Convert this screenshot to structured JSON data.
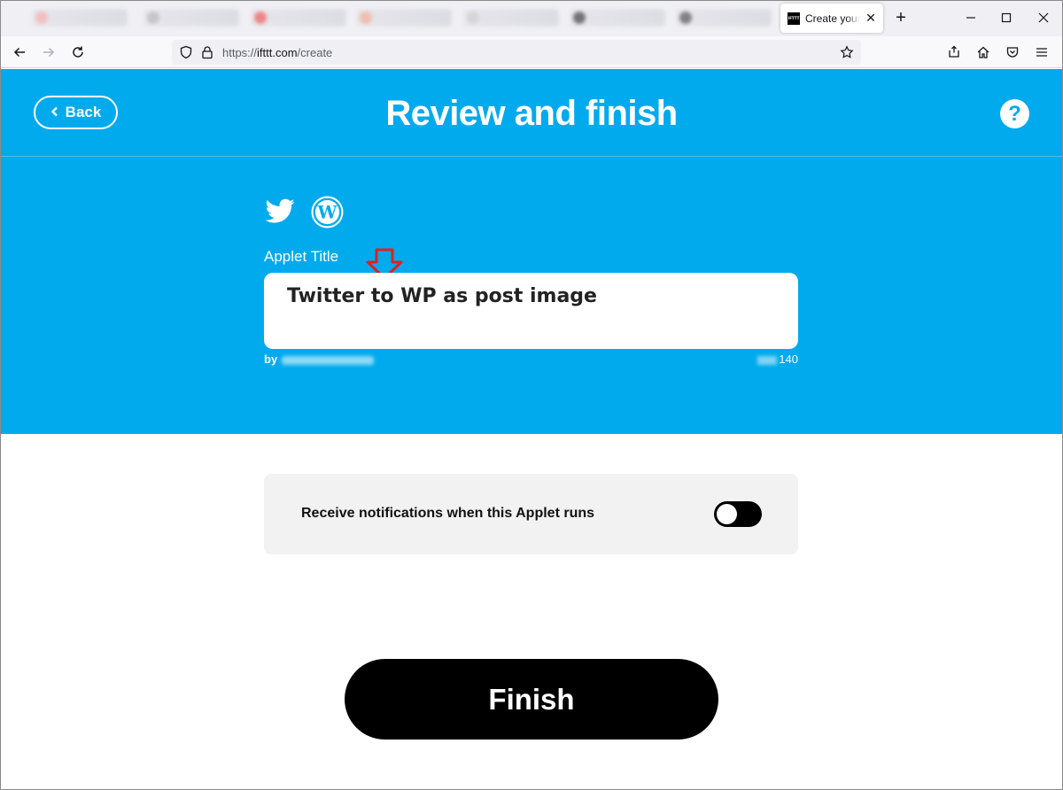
{
  "browser": {
    "active_tab": {
      "title": "Create your own",
      "favicon": "IFTTT",
      "close_icon": "close-icon"
    },
    "new_tab_label": "+",
    "url": {
      "prefix": "https://",
      "domain": "ifttt.com",
      "path": "/create"
    },
    "icons": [
      "back-arrow-icon",
      "forward-arrow-icon",
      "reload-icon",
      "shield-icon",
      "lock-icon",
      "bookmark-star-icon",
      "pocket-save-icon",
      "home-icon",
      "pocket-icon",
      "menu-icon",
      "minimize-icon",
      "maximize-icon",
      "close-window-icon"
    ]
  },
  "header": {
    "back_label": "Back",
    "title": "Review and finish",
    "help_label": "?"
  },
  "applet": {
    "services": [
      "twitter-icon",
      "wordpress-icon"
    ],
    "title_label": "Applet Title",
    "title_value": "Twitter to WP as post image",
    "by_prefix": "by",
    "max_chars": "140"
  },
  "notifications": {
    "label": "Receive notifications when this Applet runs",
    "enabled": false
  },
  "actions": {
    "finish_label": "Finish"
  },
  "colors": {
    "brand_blue": "#00aaec",
    "button_black": "#000000",
    "card_gray": "#f2f2f2",
    "annotation_red": "#e02020"
  }
}
